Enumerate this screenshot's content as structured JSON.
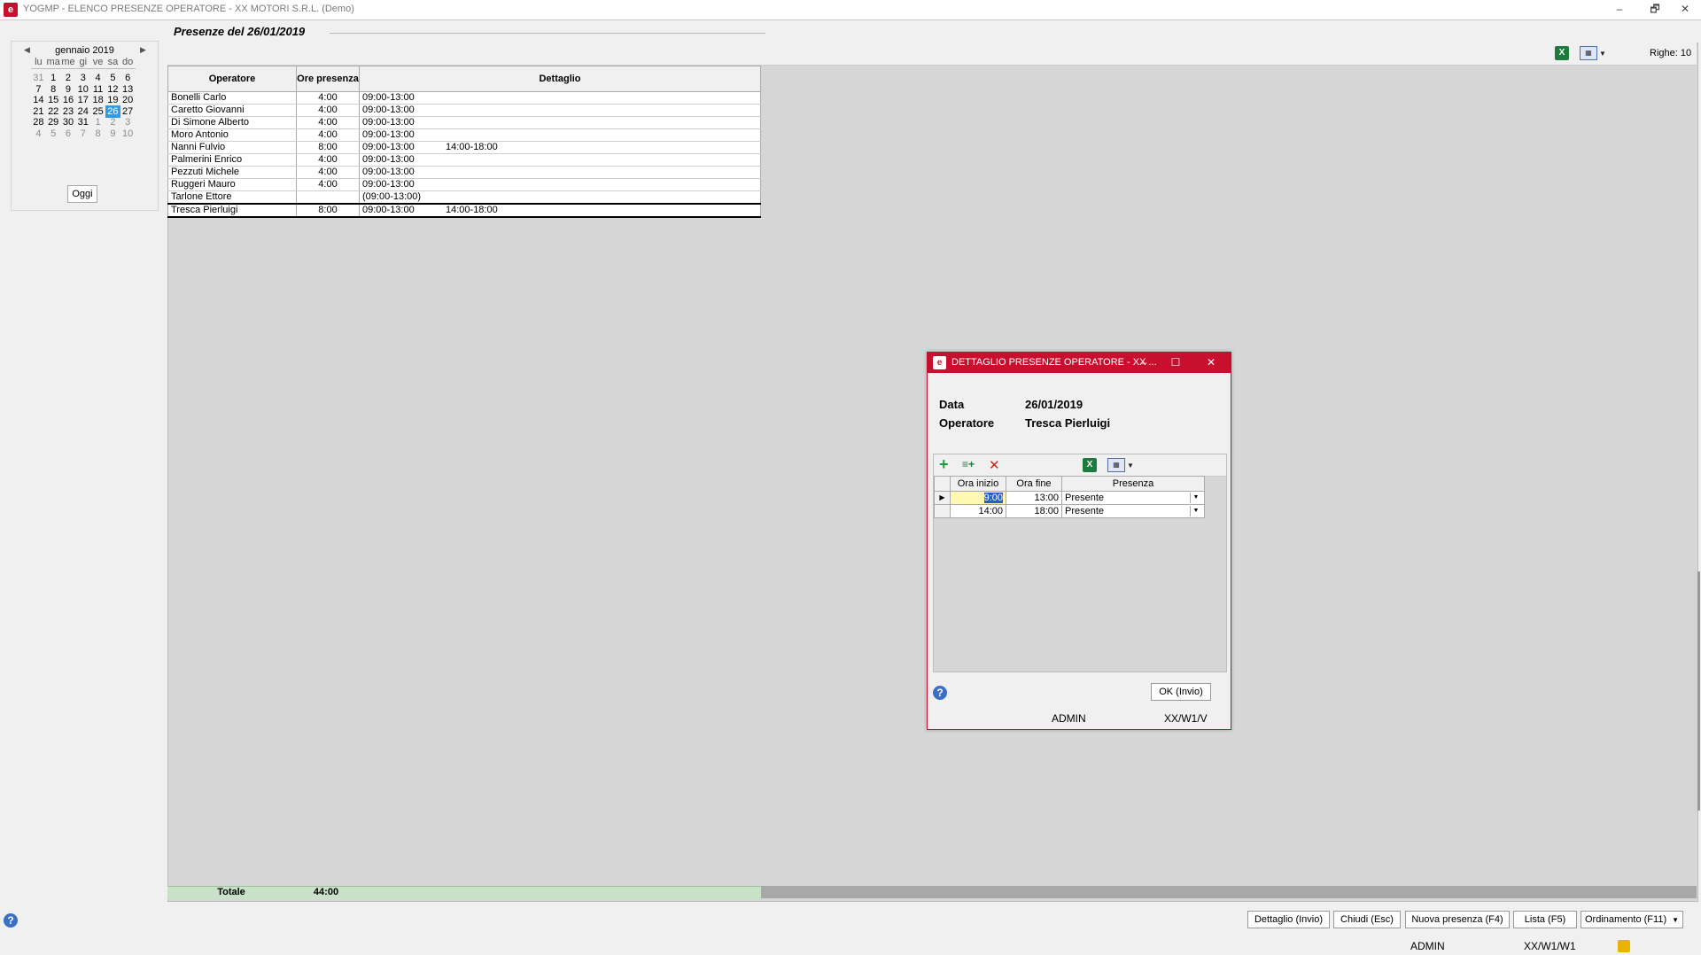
{
  "window": {
    "title": "YOGMP - ELENCO PRESENZE OPERATORE - XX  MOTORI S.R.L.  (Demo)",
    "logo_icon": "app-logo-icon",
    "minimize": "–",
    "restore": "🗗",
    "close": "✕"
  },
  "calendar": {
    "month_label": "gennaio 2019",
    "prev": "◀",
    "next": "▶",
    "weekdays": [
      "lu",
      "ma",
      "me",
      "gi",
      "ve",
      "sa",
      "do"
    ],
    "weeks": [
      [
        "31",
        "1",
        "2",
        "3",
        "4",
        "5",
        "6"
      ],
      [
        "7",
        "8",
        "9",
        "10",
        "11",
        "12",
        "13"
      ],
      [
        "14",
        "15",
        "16",
        "17",
        "18",
        "19",
        "20"
      ],
      [
        "21",
        "22",
        "23",
        "24",
        "25",
        "26",
        "27"
      ],
      [
        "28",
        "29",
        "30",
        "31",
        "1",
        "2",
        "3"
      ],
      [
        "4",
        "5",
        "6",
        "7",
        "8",
        "9",
        "10"
      ]
    ],
    "selected_day": "26",
    "today_button": "Oggi",
    "selected_color": "#2e9be8"
  },
  "section_title": "Presenze del 26/01/2019",
  "toolbar": {
    "excel_icon": "excel-icon",
    "excel_glyph": "X",
    "grid_icon": "grid-settings-icon",
    "grid_glyph": "▦",
    "dropdown_glyph": "▼",
    "rows_label": "Righe: 10"
  },
  "table": {
    "headers": [
      "Operatore",
      "Ore presenza",
      "Dettaglio"
    ],
    "rows": [
      {
        "operatore": "Bonelli Carlo",
        "ore": "4:00",
        "d1": "09:00-13:00",
        "d2": ""
      },
      {
        "operatore": "Caretto Giovanni",
        "ore": "4:00",
        "d1": "09:00-13:00",
        "d2": ""
      },
      {
        "operatore": "Di Simone Alberto",
        "ore": "4:00",
        "d1": "09:00-13:00",
        "d2": ""
      },
      {
        "operatore": "Moro Antonio",
        "ore": "4:00",
        "d1": "09:00-13:00",
        "d2": ""
      },
      {
        "operatore": "Nanni Fulvio",
        "ore": "8:00",
        "d1": "09:00-13:00",
        "d2": "14:00-18:00"
      },
      {
        "operatore": "Palmerini Enrico",
        "ore": "4:00",
        "d1": "09:00-13:00",
        "d2": ""
      },
      {
        "operatore": "Pezzuti Michele",
        "ore": "4:00",
        "d1": "09:00-13:00",
        "d2": ""
      },
      {
        "operatore": "Ruggeri Mauro",
        "ore": "4:00",
        "d1": "09:00-13:00",
        "d2": ""
      },
      {
        "operatore": "Tarlone Ettore",
        "ore": "",
        "d1": "(09:00-13:00)",
        "d2": ""
      },
      {
        "operatore": "Tresca Pierluigi",
        "ore": "8:00",
        "d1": "09:00-13:00",
        "d2": "14:00-18:00"
      }
    ],
    "total_label": "Totale",
    "total_value": "44:00",
    "total_color": "#c7e2c7"
  },
  "buttons": {
    "dettaglio": "Dettaglio (Invio)",
    "chiudi": "Chiudi (Esc)",
    "nuova": "Nuova presenza (F4)",
    "lista": "Lista (F5)",
    "ordinamento": "Ordinamento (F11)",
    "ordinamento_arrow": "▼",
    "help_glyph": "?"
  },
  "status": {
    "user": "ADMIN",
    "code": "XX/W1/W1"
  },
  "dialog": {
    "title": "DETTAGLIO PRESENZE OPERATORE - XX ...",
    "accent_color": "#c8102e",
    "data_label": "Data",
    "data_value": "26/01/2019",
    "operatore_label": "Operatore",
    "operatore_value": "Tresca Pierluigi",
    "tool_add": "+",
    "tool_insert": "≡+",
    "tool_delete": "✕",
    "headers": [
      "Ora inizio",
      "Ora fine",
      "Presenza"
    ],
    "rows": [
      {
        "indicator": "▶",
        "inizio": "9:00",
        "fine": "13:00",
        "presenza": "Presente"
      },
      {
        "indicator": "",
        "inizio": "14:00",
        "fine": "18:00",
        "presenza": "Presente"
      }
    ],
    "ok_button": "OK (Invio)",
    "user": "ADMIN",
    "code": "XX/W1/V"
  }
}
